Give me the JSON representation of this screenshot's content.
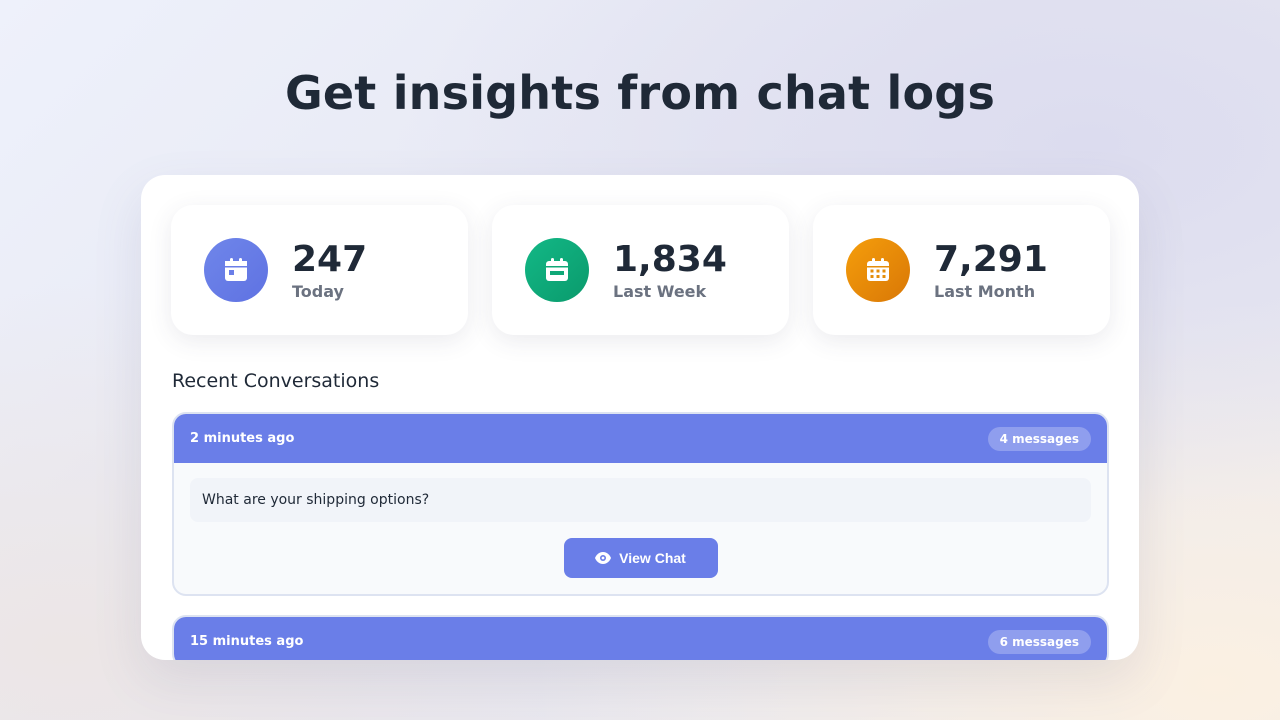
{
  "header": {
    "title": "Get insights from chat logs"
  },
  "stats": [
    {
      "value": "247",
      "label": "Today",
      "icon": "calendar-day-icon",
      "color": "#6a7ee8"
    },
    {
      "value": "1,834",
      "label": "Last Week",
      "icon": "calendar-week-icon",
      "color": "#10b981"
    },
    {
      "value": "7,291",
      "label": "Last Month",
      "icon": "calendar-month-icon",
      "color": "#f59e0b"
    }
  ],
  "recent": {
    "title": "Recent Conversations",
    "conversations": [
      {
        "time": "2 minutes ago",
        "messages": "4 messages",
        "preview": "What are your shipping options?",
        "action": "View Chat"
      },
      {
        "time": "15 minutes ago",
        "messages": "6 messages"
      }
    ]
  },
  "colors": {
    "accent": "#6a7ee8",
    "green": "#10b981",
    "orange": "#f59e0b"
  }
}
